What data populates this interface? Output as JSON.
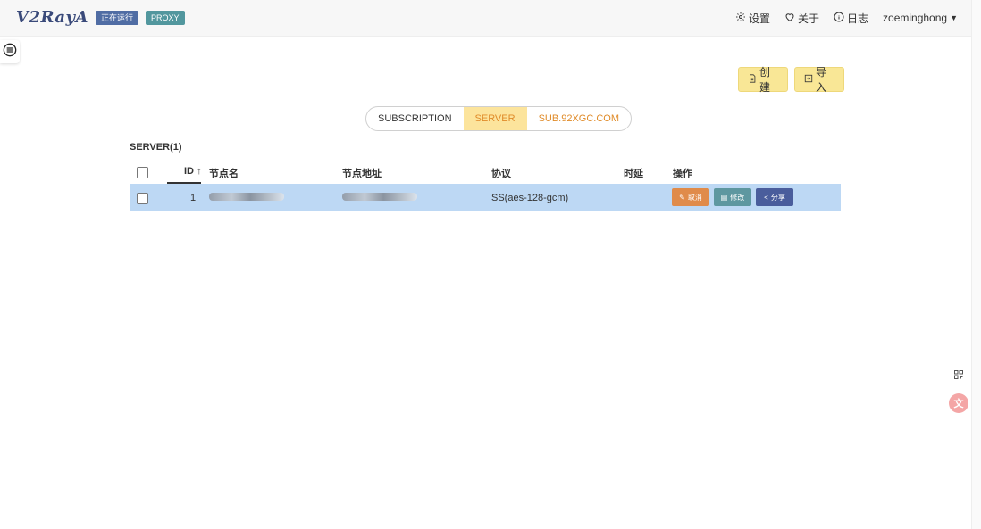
{
  "navbar": {
    "logo": "V2RayA",
    "status_badge": "正在运行",
    "mode_badge": "PROXY",
    "settings_label": "设置",
    "about_label": "关于",
    "log_label": "日志",
    "username": "zoeminghong"
  },
  "actions": {
    "create_label": "创建",
    "import_label": "导入"
  },
  "tabs": [
    {
      "label": "SUBSCRIPTION"
    },
    {
      "label": "SERVER"
    },
    {
      "label": "SUB.92XGC.COM"
    }
  ],
  "section": {
    "title": "SERVER(1)"
  },
  "table": {
    "headers": {
      "id": "ID",
      "name": "节点名",
      "address": "节点地址",
      "protocol": "协议",
      "latency": "时延",
      "operation": "操作"
    },
    "rows": [
      {
        "id": "1",
        "name": "",
        "address": "",
        "protocol": "SS(aes-128-gcm)",
        "latency": "",
        "cancel_label": "取消",
        "edit_label": "修改",
        "share_label": "分享"
      }
    ]
  },
  "floating": {
    "translate_label": "文"
  },
  "colors": {
    "selected_row": "#bdd8f4",
    "action_button": "#f9e796",
    "active_tab": "#fce49c",
    "cancel_button": "#e08b4a",
    "edit_button": "#5e97a0",
    "share_button": "#4a5d9c"
  },
  "icons": {
    "settings": "gear-icon",
    "about": "heart-icon",
    "log": "info-icon",
    "user_menu": "caret-down-icon",
    "sidebar_toggle": "list-icon",
    "create": "document-icon",
    "import": "import-icon",
    "sort": "arrow-up-icon",
    "share": "share-icon",
    "grid": "grid-icon",
    "translate": "translate-icon"
  }
}
